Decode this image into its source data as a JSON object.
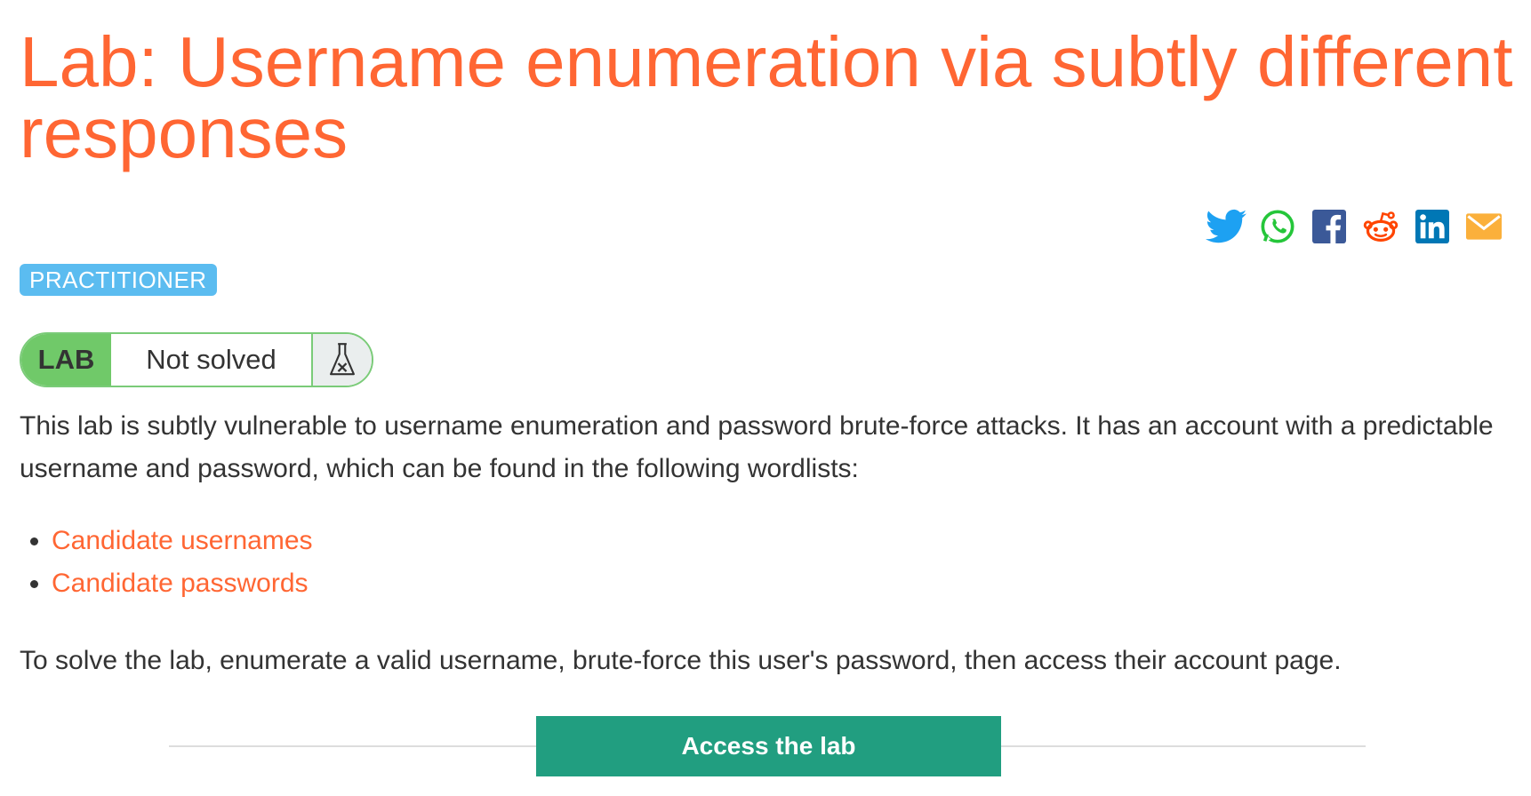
{
  "page": {
    "title": "Lab: Username enumeration via subtly different responses",
    "level": "PRACTITIONER"
  },
  "share": {
    "icons": [
      "twitter-icon",
      "whatsapp-icon",
      "facebook-icon",
      "reddit-icon",
      "linkedin-icon",
      "email-icon"
    ]
  },
  "lab_status": {
    "label": "LAB",
    "state": "Not solved",
    "icon": "flask-icon"
  },
  "content": {
    "description": "This lab is subtly vulnerable to username enumeration and password brute-force attacks. It has an account with a predictable username and password, which can be found in the following wordlists:",
    "wordlists": [
      {
        "label": "Candidate usernames"
      },
      {
        "label": "Candidate passwords"
      }
    ],
    "task": "To solve the lab, enumerate a valid username, brute-force this user's password, then access their account page."
  },
  "actions": {
    "access_label": "Access the lab"
  },
  "colors": {
    "accent": "#ff6633",
    "badge": "#5bbcf0",
    "lab_green": "#70c969",
    "button": "#219e80"
  }
}
